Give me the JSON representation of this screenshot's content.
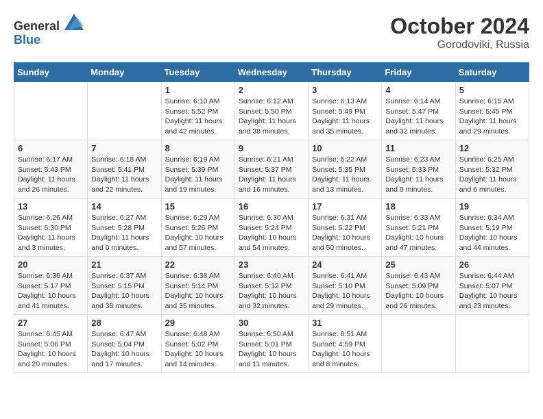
{
  "header": {
    "logo_general": "General",
    "logo_blue": "Blue",
    "month": "October 2024",
    "location": "Gorodoviki, Russia"
  },
  "days_of_week": [
    "Sunday",
    "Monday",
    "Tuesday",
    "Wednesday",
    "Thursday",
    "Friday",
    "Saturday"
  ],
  "weeks": [
    [
      null,
      null,
      {
        "day": 1,
        "sunrise": "6:10 AM",
        "sunset": "5:52 PM",
        "daylight": "11 hours and 42 minutes."
      },
      {
        "day": 2,
        "sunrise": "6:12 AM",
        "sunset": "5:50 PM",
        "daylight": "11 hours and 38 minutes."
      },
      {
        "day": 3,
        "sunrise": "6:13 AM",
        "sunset": "5:49 PM",
        "daylight": "11 hours and 35 minutes."
      },
      {
        "day": 4,
        "sunrise": "6:14 AM",
        "sunset": "5:47 PM",
        "daylight": "11 hours and 32 minutes."
      },
      {
        "day": 5,
        "sunrise": "6:15 AM",
        "sunset": "5:45 PM",
        "daylight": "11 hours and 29 minutes."
      }
    ],
    [
      {
        "day": 6,
        "sunrise": "6:17 AM",
        "sunset": "5:43 PM",
        "daylight": "11 hours and 26 minutes."
      },
      {
        "day": 7,
        "sunrise": "6:18 AM",
        "sunset": "5:41 PM",
        "daylight": "11 hours and 22 minutes."
      },
      {
        "day": 8,
        "sunrise": "6:19 AM",
        "sunset": "5:39 PM",
        "daylight": "11 hours and 19 minutes."
      },
      {
        "day": 9,
        "sunrise": "6:21 AM",
        "sunset": "5:37 PM",
        "daylight": "11 hours and 16 minutes."
      },
      {
        "day": 10,
        "sunrise": "6:22 AM",
        "sunset": "5:35 PM",
        "daylight": "11 hours and 13 minutes."
      },
      {
        "day": 11,
        "sunrise": "6:23 AM",
        "sunset": "5:33 PM",
        "daylight": "11 hours and 9 minutes."
      },
      {
        "day": 12,
        "sunrise": "6:25 AM",
        "sunset": "5:32 PM",
        "daylight": "11 hours and 6 minutes."
      }
    ],
    [
      {
        "day": 13,
        "sunrise": "6:26 AM",
        "sunset": "5:30 PM",
        "daylight": "11 hours and 3 minutes."
      },
      {
        "day": 14,
        "sunrise": "6:27 AM",
        "sunset": "5:28 PM",
        "daylight": "11 hours and 0 minutes."
      },
      {
        "day": 15,
        "sunrise": "6:29 AM",
        "sunset": "5:26 PM",
        "daylight": "10 hours and 57 minutes."
      },
      {
        "day": 16,
        "sunrise": "6:30 AM",
        "sunset": "5:24 PM",
        "daylight": "10 hours and 54 minutes."
      },
      {
        "day": 17,
        "sunrise": "6:31 AM",
        "sunset": "5:22 PM",
        "daylight": "10 hours and 50 minutes."
      },
      {
        "day": 18,
        "sunrise": "6:33 AM",
        "sunset": "5:21 PM",
        "daylight": "10 hours and 47 minutes."
      },
      {
        "day": 19,
        "sunrise": "6:34 AM",
        "sunset": "5:19 PM",
        "daylight": "10 hours and 44 minutes."
      }
    ],
    [
      {
        "day": 20,
        "sunrise": "6:36 AM",
        "sunset": "5:17 PM",
        "daylight": "10 hours and 41 minutes."
      },
      {
        "day": 21,
        "sunrise": "6:37 AM",
        "sunset": "5:15 PM",
        "daylight": "10 hours and 38 minutes."
      },
      {
        "day": 22,
        "sunrise": "6:38 AM",
        "sunset": "5:14 PM",
        "daylight": "10 hours and 35 minutes."
      },
      {
        "day": 23,
        "sunrise": "6:40 AM",
        "sunset": "5:12 PM",
        "daylight": "10 hours and 32 minutes."
      },
      {
        "day": 24,
        "sunrise": "6:41 AM",
        "sunset": "5:10 PM",
        "daylight": "10 hours and 29 minutes."
      },
      {
        "day": 25,
        "sunrise": "6:43 AM",
        "sunset": "5:09 PM",
        "daylight": "10 hours and 26 minutes."
      },
      {
        "day": 26,
        "sunrise": "6:44 AM",
        "sunset": "5:07 PM",
        "daylight": "10 hours and 23 minutes."
      }
    ],
    [
      {
        "day": 27,
        "sunrise": "6:45 AM",
        "sunset": "5:06 PM",
        "daylight": "10 hours and 20 minutes."
      },
      {
        "day": 28,
        "sunrise": "6:47 AM",
        "sunset": "5:04 PM",
        "daylight": "10 hours and 17 minutes."
      },
      {
        "day": 29,
        "sunrise": "6:48 AM",
        "sunset": "5:02 PM",
        "daylight": "10 hours and 14 minutes."
      },
      {
        "day": 30,
        "sunrise": "6:50 AM",
        "sunset": "5:01 PM",
        "daylight": "10 hours and 11 minutes."
      },
      {
        "day": 31,
        "sunrise": "6:51 AM",
        "sunset": "4:59 PM",
        "daylight": "10 hours and 8 minutes."
      },
      null,
      null
    ]
  ]
}
